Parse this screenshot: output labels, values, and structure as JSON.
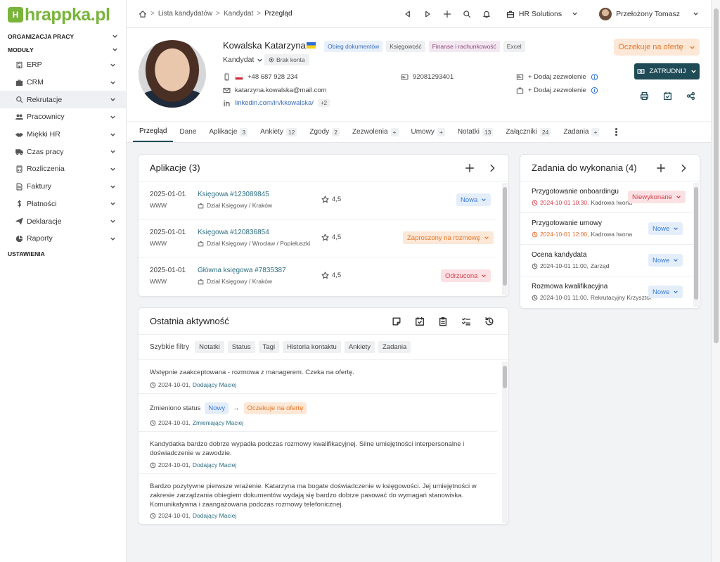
{
  "logo": {
    "badge": "H",
    "text": "hrappka.pl"
  },
  "sidebar": {
    "section_org": "ORGANIZACJA PRACY",
    "section_modules": "MODUŁY",
    "items": [
      {
        "label": "ERP",
        "icon": "building-icon"
      },
      {
        "label": "CRM",
        "icon": "briefcase-icon"
      },
      {
        "label": "Rekrutacje",
        "icon": "search-icon"
      },
      {
        "label": "Pracownicy",
        "icon": "users-icon"
      },
      {
        "label": "Miękki HR",
        "icon": "handshake-icon"
      },
      {
        "label": "Czas pracy",
        "icon": "truck-icon"
      },
      {
        "label": "Rozliczenia",
        "icon": "calculator-icon"
      },
      {
        "label": "Faktury",
        "icon": "invoice-icon"
      },
      {
        "label": "Płatności",
        "icon": "dollar-icon"
      },
      {
        "label": "Deklaracje",
        "icon": "send-icon"
      },
      {
        "label": "Raporty",
        "icon": "chart-icon"
      }
    ],
    "section_settings": "USTAWIENIA"
  },
  "topbar": {
    "breadcrumbs": [
      "Lista kandydatów",
      "Kandydat",
      "Przegląd"
    ],
    "company": "HR Solutions",
    "user": "Przełożony Tomasz"
  },
  "profile": {
    "name": "Kowalska Katarzyna",
    "tags": [
      "Obieg dokumentów",
      "Księgowość",
      "Finanse i rachunkowość",
      "Excel"
    ],
    "role": "Kandydat",
    "account": "Brak konta",
    "phone": "+48 687 928 234",
    "email": "katarzyna.kowalska@mail.com",
    "linkedin": "linkedin.com/in/kkowalska/",
    "linkedin_more": "+2",
    "id_number": "92081293401",
    "add_permit_1": "+ Dodaj zezwolenie",
    "add_permit_2": "+ Dodaj zezwolenie",
    "status_button": "Oczekuje na ofertę",
    "hire_button": "ZATRUDNIJ"
  },
  "tabs": [
    {
      "label": "Przegląd",
      "badge": ""
    },
    {
      "label": "Dane",
      "badge": ""
    },
    {
      "label": "Aplikacje",
      "badge": "3"
    },
    {
      "label": "Ankiety",
      "badge": "12"
    },
    {
      "label": "Zgody",
      "badge": "2"
    },
    {
      "label": "Zezwolenia",
      "badge": "+"
    },
    {
      "label": "Umowy",
      "badge": "+"
    },
    {
      "label": "Notatki",
      "badge": "13"
    },
    {
      "label": "Załączniki",
      "badge": "24"
    },
    {
      "label": "Zadania",
      "badge": "+"
    }
  ],
  "applications": {
    "title": "Aplikacje (3)",
    "rows": [
      {
        "date": "2025-01-01",
        "source": "WWW",
        "title": "Księgowa #123089845",
        "dept": "Dział Księgowy / Kraków",
        "rating": "4,5",
        "status": "Nowa"
      },
      {
        "date": "2025-01-01",
        "source": "WWW",
        "title": "Księgowa #120836854",
        "dept": "Dział Księgowy / Wrocław / Popiełuszki",
        "rating": "4,5",
        "status": "Zaproszony na rozmowę"
      },
      {
        "date": "2025-01-01",
        "source": "WWW",
        "title": "Główna księgowa #7835387",
        "dept": "Dział Księgowy / Kraków",
        "rating": "4,5",
        "status": "Odrzucona"
      }
    ]
  },
  "tasks": {
    "title": "Zadania do wykonania (4)",
    "rows": [
      {
        "title": "Przygotowanie onboardingu",
        "time": "2024-10-01 10:30,",
        "person": "Kadrowa Iwona",
        "status": "Niewykonane"
      },
      {
        "title": "Przygotowanie umowy",
        "time": "2024-10-01 12:00,",
        "person": "Kadrowa Iwona",
        "status": "Nowe"
      },
      {
        "title": "Ocena kandydata",
        "time": "2024-10-01 11:00,",
        "person": "Zarząd",
        "status": "Nowe"
      },
      {
        "title": "Rozmowa kwalifikacyjna",
        "time": "2024-10-01 11:00,",
        "person": "Rekrutacyjny Krzysztof",
        "status": "Nowe"
      }
    ]
  },
  "activity": {
    "title": "Ostatnia aktywność",
    "filters_label": "Szybkie filtry",
    "filters": [
      "Notatki",
      "Status",
      "Tagi",
      "Historia kontaktu",
      "Ankiety",
      "Zadania"
    ],
    "items": [
      {
        "text": "Wstępnie zaakceptowana - rozmowa z managerem. Czeka na ofertę.",
        "date": "2024-10-01,",
        "author": "Dodający Maciej"
      },
      {
        "status_label": "Zmieniono status",
        "from": "Nowy",
        "arrow": "→",
        "to": "Oczekuje na ofertę",
        "date": "2024-10-01,",
        "author": "Zmieniający Maciej"
      },
      {
        "text": "Kandydatka bardzo dobrze wypadła podczas rozmowy kwalifikacyjnej. Silne umiejętności interpersonalne i doświadczenie w zawodzie.",
        "date": "2024-10-01,",
        "author": "Dodający Maciej"
      },
      {
        "text": "Bardzo pozytywne pierwsze wrażenie. Katarzyna ma bogate doświadczenie w księgowości. Jej umiejętności w zakresie zarządzania obiegiem dokumentów wydają się bardzo dobrze pasować do wymagań stanowiska. Komunikatywna i zaangażowana podczas rozmowy telefonicznej.",
        "date": "2024-10-01,",
        "author": "Dodający Maciej"
      }
    ]
  }
}
